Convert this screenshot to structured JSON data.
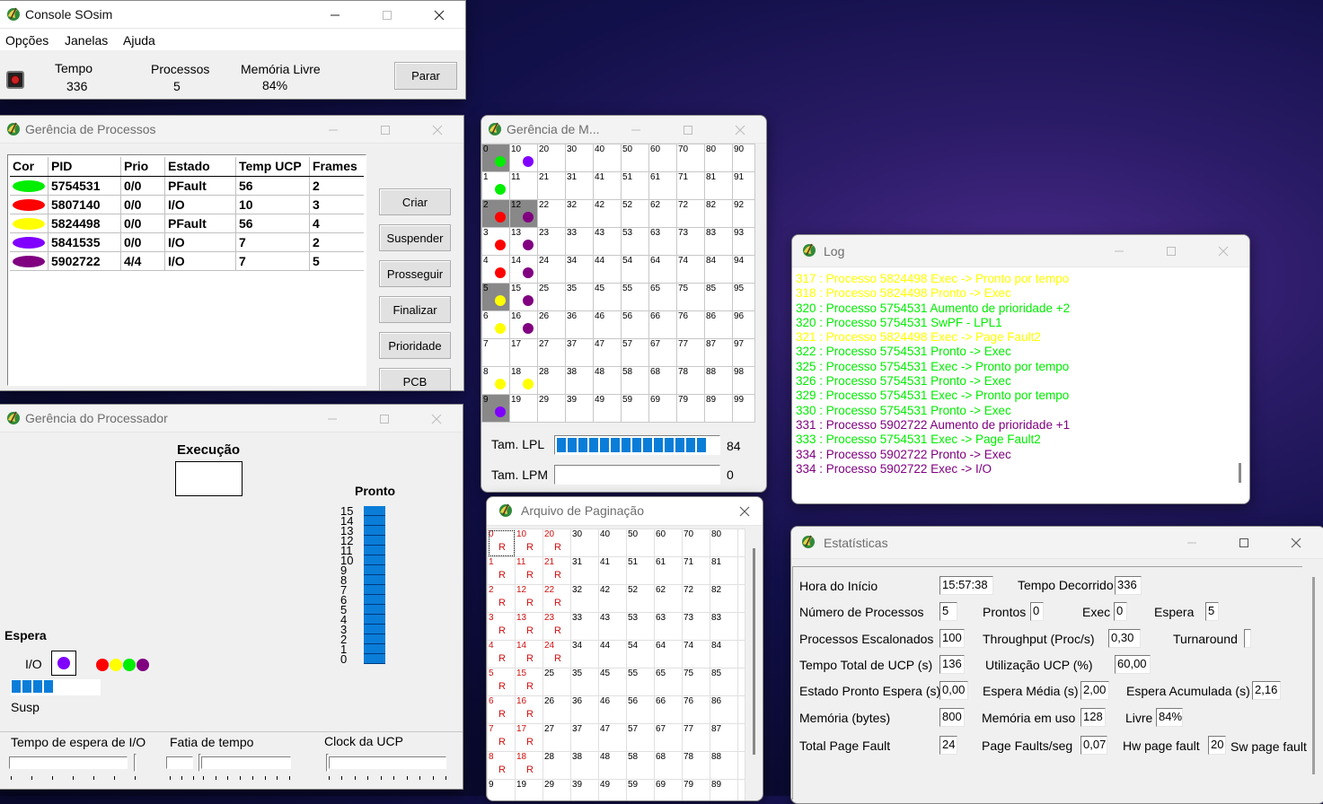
{
  "colors": {
    "green": "#00ee00",
    "red": "#ff0000",
    "yellow": "#ffff00",
    "violet": "#8000ff",
    "purple": "#800080",
    "progress_blue": "#0a7dd8"
  },
  "console": {
    "title": "Console SOsim",
    "menu": [
      "Opções",
      "Janelas",
      "Ajuda"
    ],
    "stats": [
      {
        "label": "Tempo",
        "value": "336"
      },
      {
        "label": "Processos",
        "value": "5"
      },
      {
        "label": "Memória Livre",
        "value": "84%"
      }
    ],
    "stop_label": "Parar"
  },
  "processes": {
    "title": "Gerência de Processos",
    "headers": [
      "Cor",
      "PID",
      "Prio",
      "Estado",
      "Temp UCP",
      "Frames"
    ],
    "rows": [
      {
        "color": "#00ee00",
        "pid": "5754531",
        "prio": "0/0",
        "estado": "PFault",
        "temp": "56",
        "frames": "2"
      },
      {
        "color": "#ff0000",
        "pid": "5807140",
        "prio": "0/0",
        "estado": "I/O",
        "temp": "10",
        "frames": "3"
      },
      {
        "color": "#ffff00",
        "pid": "5824498",
        "prio": "0/0",
        "estado": "PFault",
        "temp": "56",
        "frames": "4"
      },
      {
        "color": "#8000ff",
        "pid": "5841535",
        "prio": "0/0",
        "estado": "I/O",
        "temp": "7",
        "frames": "2"
      },
      {
        "color": "#800080",
        "pid": "5902722",
        "prio": "4/4",
        "estado": "I/O",
        "temp": "7",
        "frames": "5"
      }
    ],
    "buttons": [
      "Criar",
      "Suspender",
      "Prosseguir",
      "Finalizar",
      "Prioridade",
      "PCB"
    ]
  },
  "processor": {
    "title": "Gerência do Processador",
    "execucao": "Execução",
    "pronto": "Pronto",
    "pronto_levels": [
      "15",
      "14",
      "13",
      "12",
      "11",
      "10",
      "9",
      "8",
      "7",
      "6",
      "5",
      "4",
      "3",
      "2",
      "1",
      "0"
    ],
    "espera": "Espera",
    "io": "I/O",
    "io_current": "#8000ff",
    "io_queue": [
      "#ff0000",
      "#ffff00",
      "#00ee00",
      "#800080"
    ],
    "susp": "Susp",
    "susp_progress": 4,
    "sliders": [
      "Tempo de espera de I/O",
      "Fatia de tempo",
      "Clock da UCP"
    ]
  },
  "memory": {
    "title": "Gerência de M...",
    "cols": [
      "0",
      "10",
      "20",
      "30",
      "40",
      "50",
      "60",
      "70",
      "80",
      "90"
    ],
    "frames": {
      "0": "#00ee00",
      "10": "#8000ff",
      "1": "#00ee00",
      "2": "#ff0000",
      "12": "#800080",
      "3": "#ff0000",
      "13": "#800080",
      "4": "#ff0000",
      "14": "#800080",
      "5": "#ffff00",
      "15": "#800080",
      "6": "#ffff00",
      "16": "#800080",
      "8": "#ffff00",
      "18": "#ffff00",
      "9": "#8000ff"
    },
    "occupied": [
      "0",
      "2",
      "12",
      "5",
      "9"
    ],
    "lpl_label": "Tam. LPL",
    "lpl_value": "84",
    "lpl_progress": 14,
    "lpm_label": "Tam. LPM",
    "lpm_value": "0",
    "lpm_progress": 0
  },
  "paging": {
    "title": "Arquivo de Paginação",
    "r_mark": "R",
    "r_cells": [
      "0",
      "10",
      "20",
      "1",
      "11",
      "21",
      "2",
      "12",
      "22",
      "3",
      "13",
      "23",
      "4",
      "14",
      "24",
      "5",
      "15",
      "6",
      "16",
      "7",
      "17",
      "8",
      "18"
    ]
  },
  "log": {
    "title": "Log",
    "lines": [
      {
        "text": "317 : Processo 5824498 Exec -> Pronto por tempo",
        "color": "#ffff00"
      },
      {
        "text": "318 : Processo 5824498 Pronto -> Exec",
        "color": "#ffff00"
      },
      {
        "text": "320 : Processo 5754531 Aumento de prioridade +2",
        "color": "#00ee00"
      },
      {
        "text": "320 : Processo 5754531 SwPF - LPL1",
        "color": "#00ee00"
      },
      {
        "text": "321 : Processo 5824498 Exec -> Page Fault2",
        "color": "#ffff00"
      },
      {
        "text": "322 : Processo 5754531 Pronto -> Exec",
        "color": "#00ee00"
      },
      {
        "text": "325 : Processo 5754531 Exec -> Pronto por tempo",
        "color": "#00ee00"
      },
      {
        "text": "326 : Processo 5754531 Pronto -> Exec",
        "color": "#00ee00"
      },
      {
        "text": "329 : Processo 5754531 Exec -> Pronto por tempo",
        "color": "#00ee00"
      },
      {
        "text": "330 : Processo 5754531 Pronto -> Exec",
        "color": "#00ee00"
      },
      {
        "text": "331 : Processo 5902722 Aumento de prioridade +1",
        "color": "#800080"
      },
      {
        "text": "333 : Processo 5754531 Exec -> Page Fault2",
        "color": "#00ee00"
      },
      {
        "text": "334 : Processo 5902722 Pronto -> Exec",
        "color": "#800080"
      },
      {
        "text": "334 : Processo 5902722 Exec -> I/O",
        "color": "#800080"
      }
    ]
  },
  "stats": {
    "title": "Estatísticas",
    "hora_inicio_label": "Hora do Início",
    "hora_inicio": "15:57:38",
    "tempo_decorrido_label": "Tempo Decorrido",
    "tempo_decorrido": "336",
    "num_proc_label": "Número de Processos",
    "num_proc": "5",
    "prontos_label": "Prontos",
    "prontos": "0",
    "exec_label": "Exec",
    "exec": "0",
    "espera_label": "Espera",
    "espera": "5",
    "escalonados_label": "Processos Escalonados",
    "escalonados": "100",
    "throughput_label": "Throughput (Proc/s)",
    "throughput": "0,30",
    "turnaround_label": "Turnaround",
    "turnaround": "",
    "tempo_ucp_label": "Tempo Total de UCP (s)",
    "tempo_ucp": "136",
    "util_ucp_label": "Utilização UCP (%)",
    "util_ucp": "60,00",
    "pronto_espera_label": "Estado Pronto Espera (s)",
    "pronto_espera": "0,00",
    "espera_media_label": "Espera Média (s)",
    "espera_media": "2,00",
    "espera_acum_label": "Espera Acumulada (s)",
    "espera_acum": "2,16",
    "memoria_label": "Memória (bytes)",
    "memoria": "800",
    "mem_uso_label": "Memória em uso",
    "mem_uso": "128",
    "livre_label": "Livre",
    "livre": "84%",
    "page_fault_label": "Total Page Fault",
    "page_fault": "24",
    "pf_seg_label": "Page Faults/seg",
    "pf_seg": "0,07",
    "hw_pf_label": "Hw page fault",
    "hw_pf": "20",
    "sw_pf_label": "Sw page fault"
  }
}
